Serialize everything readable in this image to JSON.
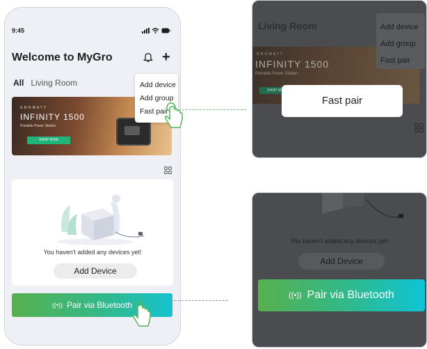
{
  "phone": {
    "status": {
      "time": "9:45"
    },
    "title": "Welcome to MyGro",
    "tabs": [
      "All",
      "Living Room"
    ],
    "menu": [
      "Add device",
      "Add group",
      "Fast pair"
    ],
    "banner": {
      "brand": "GROWATT",
      "product": "INFINITY 1500",
      "subtitle": "Portable Power Station",
      "cta": "SHOP NOW"
    },
    "empty_text": "You haven't added any devices yet!",
    "add_device_label": "Add Device",
    "bluetooth_label": "Pair via Bluetooth",
    "bluetooth_glyph": "((•))"
  },
  "zoom_fastpair": {
    "room": "Living Room",
    "menu": [
      "Add device",
      "Add group",
      "Fast pair"
    ],
    "banner_brand": "GROWATT",
    "banner_product": "INFINITY 1500",
    "banner_subtitle": "Portable Power Station",
    "banner_cta": "SHOP NOW",
    "popup": "Fast pair"
  },
  "zoom_bluetooth": {
    "empty_text": "You haven't added any devices yet!",
    "add_device_label": "Add Device",
    "bluetooth_label": "Pair via Bluetooth",
    "bluetooth_glyph": "((•))"
  },
  "colors": {
    "accent_start": "#57b04e",
    "accent_end": "#15c2cf",
    "connector": "#6fc27a"
  }
}
